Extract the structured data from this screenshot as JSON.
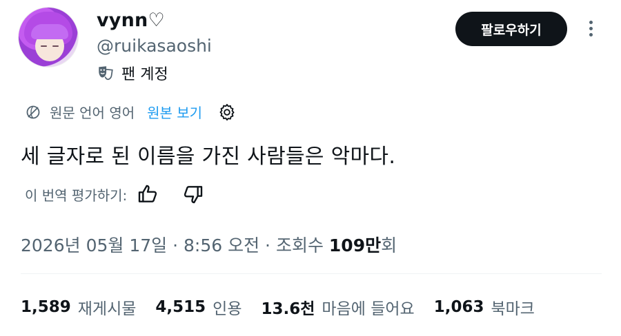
{
  "user": {
    "display_name": "vynn♡",
    "handle": "@ruikasaoshi",
    "badge_label": "팬 계정"
  },
  "follow_button": "팔로우하기",
  "translation": {
    "source_text": "원문 언어 영어",
    "show_original": "원본 보기"
  },
  "tweet": {
    "text": "세 글자로 된 이름을 가진 사람들은 악마다."
  },
  "rating": {
    "label": "이 번역 평가하기:"
  },
  "meta": {
    "date": "2026년 05월 17일",
    "time": "8:56 오전",
    "views_label": "조회수",
    "views_number": "109만",
    "views_suffix": "회",
    "separator": "·"
  },
  "stats": [
    {
      "number": "1,589",
      "label": "재게시물"
    },
    {
      "number": "4,515",
      "label": "인용"
    },
    {
      "number": "13.6천",
      "label": "마음에 들어요"
    },
    {
      "number": "1,063",
      "label": "북마크"
    }
  ],
  "colors": {
    "accent": "#1d9bf0",
    "text_primary": "#0f1419",
    "text_secondary": "#536471",
    "button_bg": "#0f1419"
  },
  "icons": {
    "more": "more-vertical-icon",
    "fan": "theater-mask-icon",
    "translate": "globe-icon",
    "settings": "gear-icon",
    "like": "thumbs-up-icon",
    "dislike": "thumbs-down-icon"
  }
}
